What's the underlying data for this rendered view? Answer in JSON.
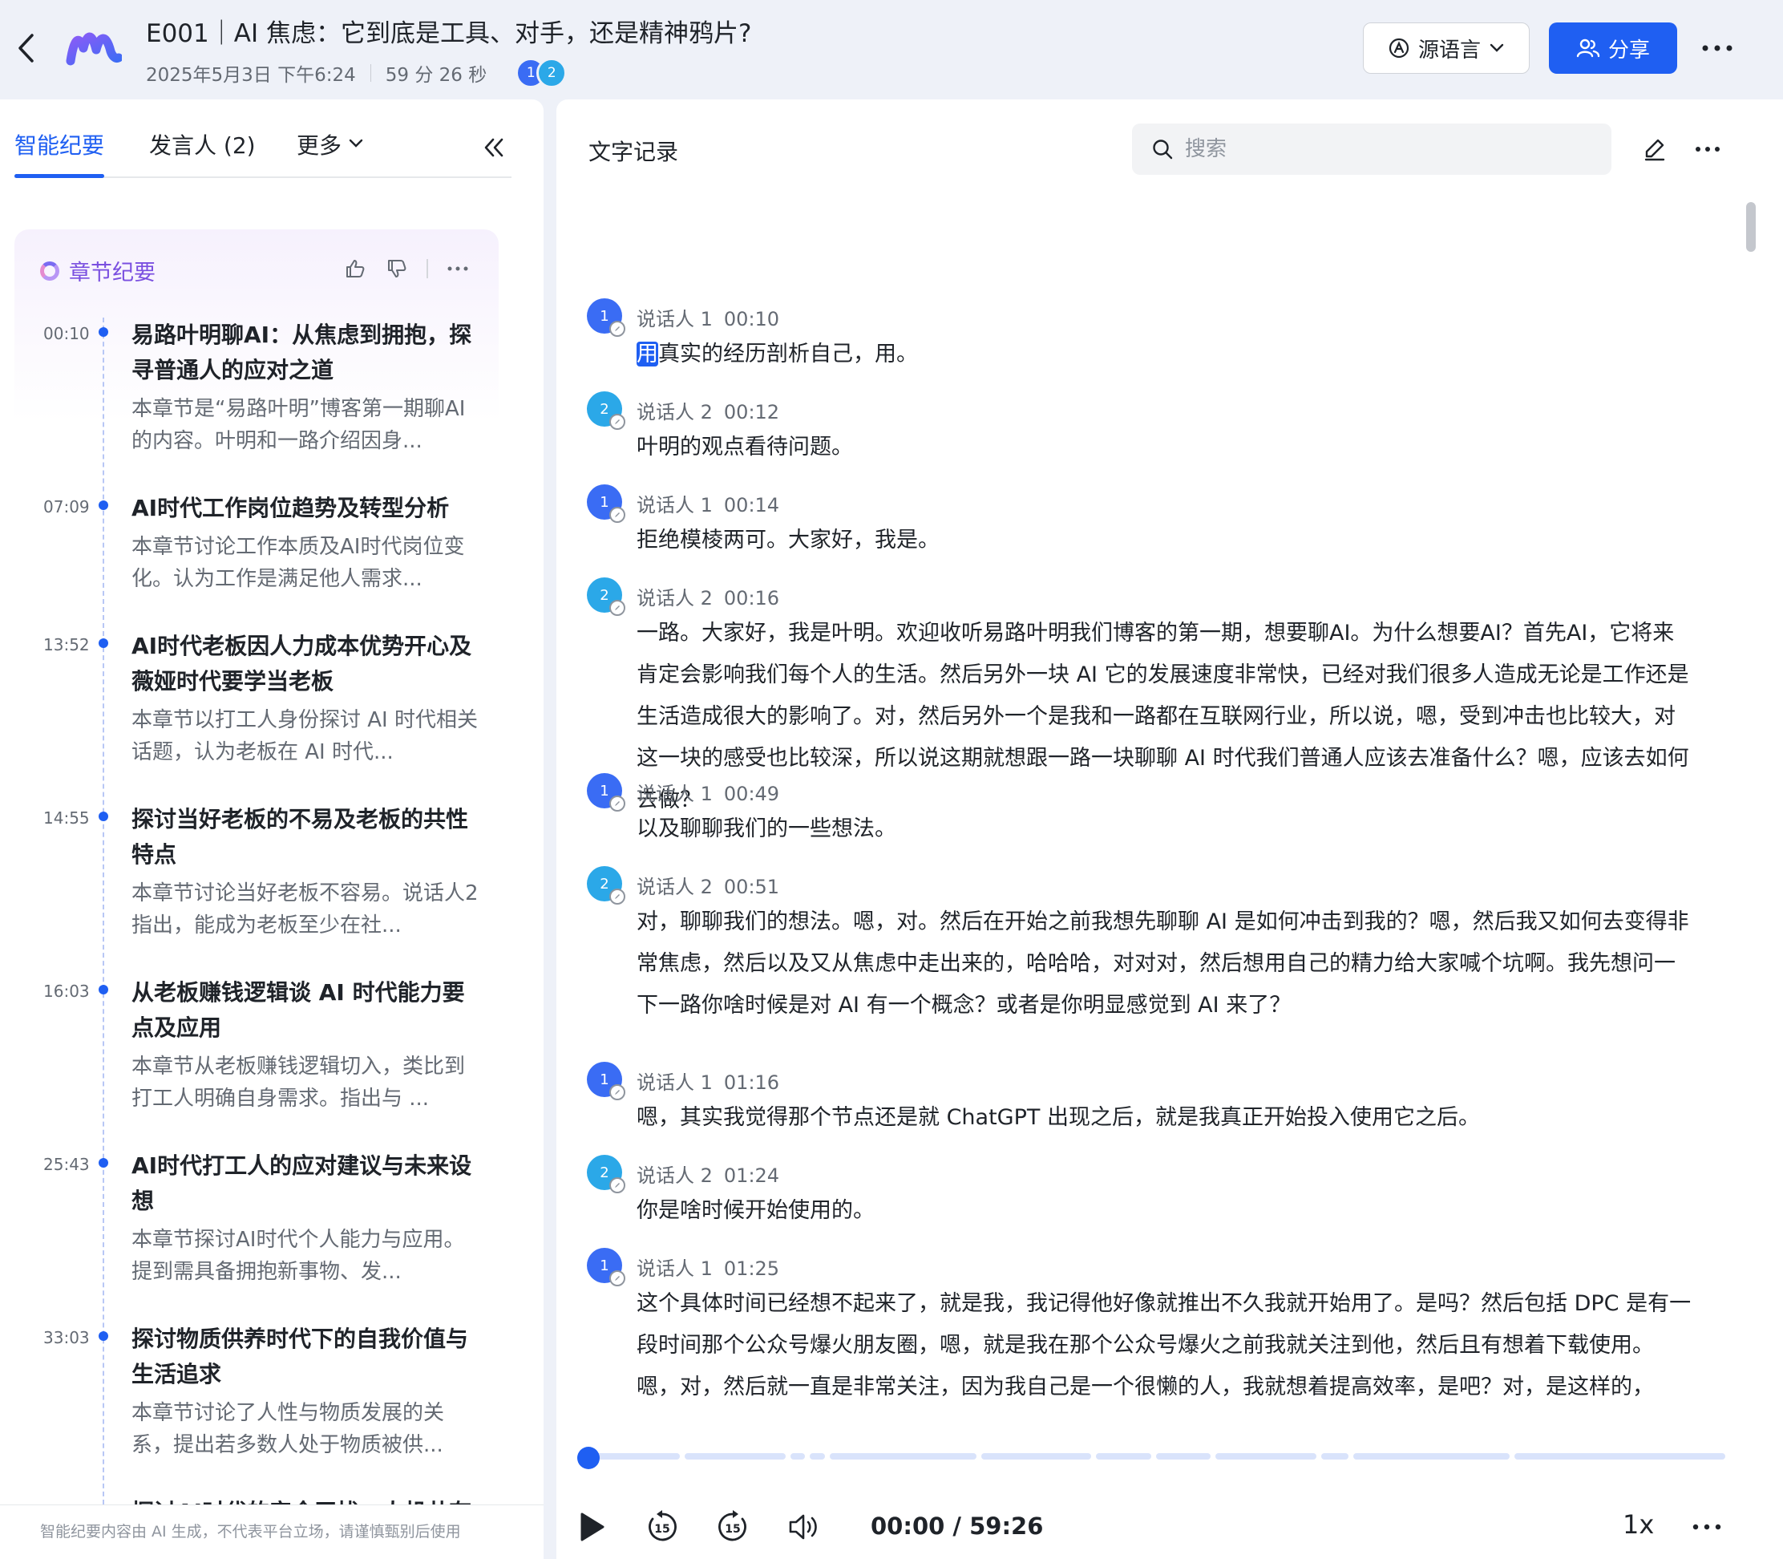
{
  "header": {
    "title": "E001｜AI 焦虑：它到底是工具、对手，还是精神鸦片?",
    "date": "2025年5月3日 下午6:24",
    "duration": "59 分 26 秒",
    "participants": [
      "1",
      "2"
    ],
    "language_button": "源语言",
    "share_button": "分享"
  },
  "left": {
    "tabs": [
      "智能纪要",
      "发言人 (2)",
      "更多"
    ],
    "section_title": "章节纪要",
    "chapters": [
      {
        "time": "00:10",
        "title": "易路叶明聊AI：从焦虑到拥抱，探寻普通人的应对之道",
        "desc": "本章节是“易路叶明”博客第一期聊AI的内容。叶明和一路介绍因身..."
      },
      {
        "time": "07:09",
        "title": "AI时代工作岗位趋势及转型分析",
        "desc": "本章节讨论工作本质及AI时代岗位变化。认为工作是满足他人需求..."
      },
      {
        "time": "13:52",
        "title": "AI时代老板因人力成本优势开心及薇娅时代要学当老板",
        "desc": "本章节以打工人身份探讨 AI 时代相关话题，认为老板在 AI 时代..."
      },
      {
        "time": "14:55",
        "title": "探讨当好老板的不易及老板的共性特点",
        "desc": "本章节讨论当好老板不容易。说话人2指出，能成为老板至少在社..."
      },
      {
        "time": "16:03",
        "title": "从老板赚钱逻辑谈 AI 时代能力要点及应用",
        "desc": "本章节从老板赚钱逻辑切入，类比到打工人明确自身需求。指出与 ..."
      },
      {
        "time": "25:43",
        "title": "AI时代打工人的应对建议与未来设想",
        "desc": "本章节探讨AI时代个人能力与应用。提到需具备拥抱新事物、发..."
      },
      {
        "time": "33:03",
        "title": "探讨物质供养时代下的自我价值与生活追求",
        "desc": "本章节讨论了人性与物质发展的关系，提出若多数人处于物质被供..."
      },
      {
        "time": "",
        "title": "探讨AI时代的安全干扰、人机共存",
        "desc": ""
      }
    ],
    "footer": "智能纪要内容由 AI 生成，不代表平台立场，请谨慎甄别后使用"
  },
  "right": {
    "title": "文字记录",
    "search_placeholder": "搜索",
    "segments": [
      {
        "speaker": "说话人 1",
        "num": "1",
        "time": "00:10",
        "hl": "用",
        "text": "真实的经历剖析自己，用。"
      },
      {
        "speaker": "说话人 2",
        "num": "2",
        "time": "00:12",
        "hl": "",
        "text": "叶明的观点看待问题。"
      },
      {
        "speaker": "说话人 1",
        "num": "1",
        "time": "00:14",
        "hl": "",
        "text": "拒绝模棱两可。大家好，我是。"
      },
      {
        "speaker": "说话人 2",
        "num": "2",
        "time": "00:16",
        "hl": "",
        "text": "一路。大家好，我是叶明。欢迎收听易路叶明我们博客的第一期，想要聊AI。为什么想要AI？首先AI，它将来肯定会影响我们每个人的生活。然后另外一块 AI 它的发展速度非常快，已经对我们很多人造成无论是工作还是生活造成很大的影响了。对，然后另外一个是我和一路都在互联网行业，所以说，嗯，受到冲击也比较大，对这一块的感受也比较深，所以说这期就想跟一路一块聊聊 AI 时代我们普通人应该去准备什么？嗯，应该去如何去做？"
      },
      {
        "speaker": "说话人 1",
        "num": "1",
        "time": "00:49",
        "hl": "",
        "text": "以及聊聊我们的一些想法。"
      },
      {
        "speaker": "说话人 2",
        "num": "2",
        "time": "00:51",
        "hl": "",
        "text": "对，聊聊我们的想法。嗯，对。然后在开始之前我想先聊聊 AI 是如何冲击到我的？嗯，然后我又如何去变得非常焦虑，然后以及又从焦虑中走出来的，哈哈哈，对对对，然后想用自己的精力给大家喊个坑啊。我先想问一下一路你啥时候是对 AI 有一个概念？或者是你明显感觉到 AI 来了？"
      },
      {
        "speaker": "说话人 1",
        "num": "1",
        "time": "01:16",
        "hl": "",
        "text": "嗯，其实我觉得那个节点还是就 ChatGPT 出现之后，就是我真正开始投入使用它之后。"
      },
      {
        "speaker": "说话人 2",
        "num": "2",
        "time": "01:24",
        "hl": "",
        "text": "你是啥时候开始使用的。"
      },
      {
        "speaker": "说话人 1",
        "num": "1",
        "time": "01:25",
        "hl": "",
        "text": "这个具体时间已经想不起来了，就是我，我记得他好像就推出不久我就开始用了。是吗？然后包括 DPC 是有一段时间那个公众号爆火朋友圈，嗯，就是我在那个公众号爆火之前我就关注到他，然后且有想着下载使用。嗯，对，然后就一直是非常关注，因为我自己是一个很懒的人，我就想着提高效率，是吧？对，是这样的，嗯。"
      }
    ]
  },
  "player": {
    "time_display": "00:00 / 59:26",
    "speed": "1x",
    "progress": 0,
    "segment_weights": [
      1,
      1.1,
      0.16,
      0.16,
      1.6,
      1.2,
      0.6,
      0.6,
      1.1,
      0.3,
      1.7,
      2.3
    ]
  },
  "colors": {
    "accent": "#1f5ff2",
    "speaker1": "#3a6cf4",
    "speaker2": "#2ba8e8",
    "chapter_title": "#7a4fe0"
  }
}
